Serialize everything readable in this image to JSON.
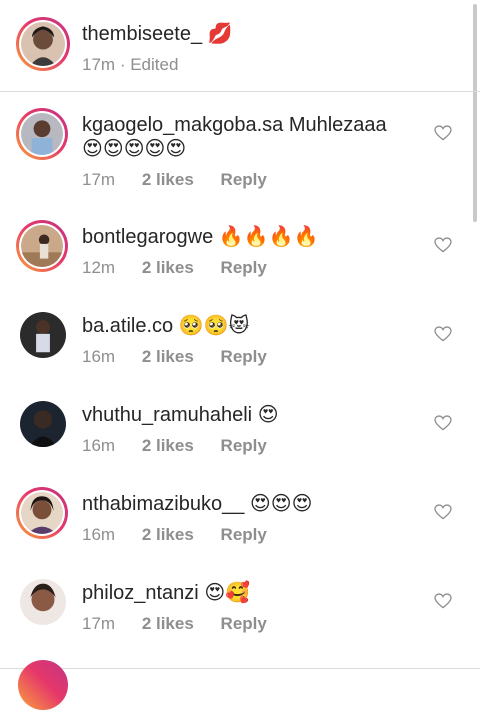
{
  "post": {
    "username": "thembiseete_",
    "emoji": "💋",
    "time": "17m",
    "separator": "·",
    "edited": "Edited"
  },
  "comments": [
    {
      "username": "kgaogelo_makgoba.sa",
      "text": "Muhlezaaa",
      "emoji_line": "😍😍😍😍😍",
      "time": "17m",
      "likes": "2 likes",
      "reply": "Reply",
      "ring": true
    },
    {
      "username": "bontlegarogwe",
      "text": "",
      "emoji_line": "🔥🔥🔥🔥",
      "time": "12m",
      "likes": "2 likes",
      "reply": "Reply",
      "ring": true
    },
    {
      "username": "ba.atile.co",
      "text": "",
      "emoji_line": "🥺🥺😻",
      "time": "16m",
      "likes": "2 likes",
      "reply": "Reply",
      "ring": false
    },
    {
      "username": "vhuthu_ramuhaheli",
      "text": "",
      "emoji_line": "😍",
      "time": "16m",
      "likes": "2 likes",
      "reply": "Reply",
      "ring": false
    },
    {
      "username": "nthabimazibuko__",
      "text": "",
      "emoji_line": "😍😍😍",
      "time": "16m",
      "likes": "2 likes",
      "reply": "Reply",
      "ring": true
    },
    {
      "username": "philoz_ntanzi",
      "text": "",
      "emoji_line": "😍🥰",
      "time": "17m",
      "likes": "2 likes",
      "reply": "Reply",
      "ring": false
    }
  ],
  "icons": {
    "heart": "heart-outline-icon"
  },
  "colors": {
    "text": "#262626",
    "meta": "#8e8e8e",
    "divider": "#dbdbdb",
    "ring_start": "#f9a23a",
    "ring_end": "#c13584"
  }
}
